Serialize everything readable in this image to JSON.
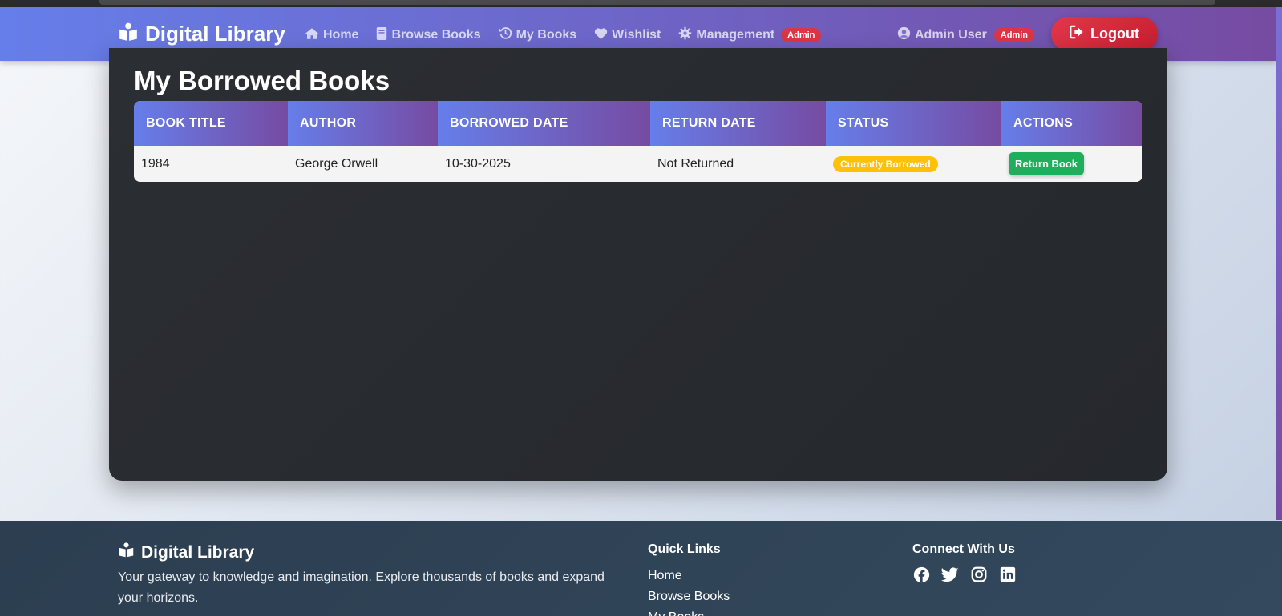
{
  "nav": {
    "brand": "Digital Library",
    "links": [
      {
        "label": "Home",
        "icon": "home-icon"
      },
      {
        "label": "Browse Books",
        "icon": "book-icon"
      },
      {
        "label": "My Books",
        "icon": "history-icon"
      },
      {
        "label": "Wishlist",
        "icon": "heart-icon"
      },
      {
        "label": "Management",
        "icon": "gear-icon"
      }
    ],
    "management_badge": "Admin",
    "user_name": "Admin User",
    "user_badge": "Admin",
    "logout_label": "Logout"
  },
  "main": {
    "title": "My Borrowed Books",
    "columns": [
      "BOOK TITLE",
      "AUTHOR",
      "BORROWED DATE",
      "RETURN DATE",
      "STATUS",
      "ACTIONS"
    ],
    "rows": [
      {
        "title": "1984",
        "author": "George Orwell",
        "borrowed": "10-30-2025",
        "returned": "Not Returned",
        "status": "Currently Borrowed",
        "action": "Return Book"
      }
    ]
  },
  "footer": {
    "brand": "Digital Library",
    "description": "Your gateway to knowledge and imagination. Explore thousands of books and expand your horizons.",
    "quick_links_title": "Quick Links",
    "quick_links": [
      "Home",
      "Browse Books",
      "My Books"
    ],
    "connect_title": "Connect With Us",
    "social": [
      "facebook-icon",
      "twitter-icon",
      "instagram-icon",
      "linkedin-icon"
    ]
  },
  "colors": {
    "nav_gradient_start": "#667eea",
    "nav_gradient_end": "#764ba2",
    "danger": "#dc3545",
    "warning": "#ffc107",
    "success": "#1fae5b",
    "footer": "#2c3e50"
  }
}
